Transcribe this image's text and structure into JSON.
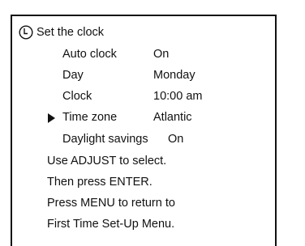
{
  "menu": {
    "title": "Set the clock",
    "icon": "clock-icon",
    "selected_item": "Time zone",
    "settings": [
      {
        "label": "Auto clock",
        "value": "On"
      },
      {
        "label": "Day",
        "value": "Monday"
      },
      {
        "label": "Clock",
        "value": "10:00 am"
      },
      {
        "label": "Time zone",
        "value": "Atlantic"
      },
      {
        "label": "Daylight savings",
        "value": "On"
      }
    ],
    "instructions": [
      "Use ADJUST to select.",
      "Then press ENTER.",
      "Press MENU to return to",
      "First Time Set-Up Menu."
    ]
  }
}
